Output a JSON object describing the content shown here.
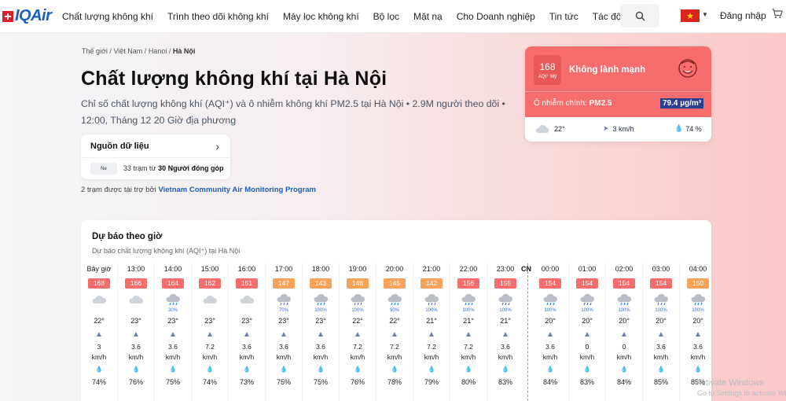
{
  "nav": {
    "logo": "IQAir",
    "items": [
      "Chất lượng không khí",
      "Trình theo dõi không khí",
      "Máy lọc không khí",
      "Bộ lọc",
      "Mặt nạ",
      "Cho Doanh nghiệp",
      "Tin tức",
      "Tác động"
    ],
    "login": "Đăng nhập"
  },
  "breadcrumb": {
    "world": "Thế giới",
    "country": "Việt Nam",
    "city": "Hanoi",
    "current": "Hà Nội"
  },
  "title": "Chất lượng không khí tại Hà Nội",
  "description": "Chỉ số chất lượng không khí (AQI⁺) và ô nhiễm không khí PM2.5 tại Hà Nội • 2.9M người theo dõi • 12:00, Tháng 12 20 Giờ địa phương",
  "source": {
    "title": "Nguồn dữ liệu",
    "logo_text": "Ne",
    "text_a": "33 trạm từ",
    "text_b": "30 Người đóng góp"
  },
  "sponsor": {
    "prefix": "2 trạm được tài trợ bởi",
    "link": "Vietnam Community Air Monitoring Program"
  },
  "aqi": {
    "value": "168",
    "unit": "AQI⁺ Mỹ",
    "status": "Không lành mạnh",
    "pollutant_label": "Ô nhiễm chính:",
    "pollutant": "PM2.5",
    "concentration": "79.4 µg/m³",
    "temp": "22°",
    "wind": "3 km/h",
    "humidity": "74 %",
    "colors": {
      "card": "#f76d6d",
      "badge": "#e85858"
    }
  },
  "forecast": {
    "title": "Dự báo theo giờ",
    "subtitle": "Dự báo chất lượng không khí (AQI⁺) tại Hà Nội",
    "day_marker": "CN",
    "hours": [
      {
        "time": "Bây giờ",
        "aqi": "168",
        "level": "red",
        "icon": "cloud-icon",
        "rain": "",
        "temp": "22°",
        "wind": "3",
        "unit": "km/h",
        "hum": "74%"
      },
      {
        "time": "13:00",
        "aqi": "166",
        "level": "red",
        "icon": "cloud-icon",
        "rain": "",
        "temp": "23°",
        "wind": "3.6",
        "unit": "km/h",
        "hum": "76%"
      },
      {
        "time": "14:00",
        "aqi": "164",
        "level": "red",
        "icon": "rain-cloud-icon",
        "rain": "30%",
        "temp": "23°",
        "wind": "3.6",
        "unit": "km/h",
        "hum": "75%"
      },
      {
        "time": "15:00",
        "aqi": "162",
        "level": "red",
        "icon": "cloud-icon",
        "rain": "",
        "temp": "23°",
        "wind": "7.2",
        "unit": "km/h",
        "hum": "74%"
      },
      {
        "time": "16:00",
        "aqi": "151",
        "level": "red",
        "icon": "cloud-icon",
        "rain": "",
        "temp": "23°",
        "wind": "3.6",
        "unit": "km/h",
        "hum": "73%"
      },
      {
        "time": "17:00",
        "aqi": "147",
        "level": "orange",
        "icon": "rain-cloud-icon",
        "rain": "70%",
        "temp": "23°",
        "wind": "3.6",
        "unit": "km/h",
        "hum": "75%"
      },
      {
        "time": "18:00",
        "aqi": "143",
        "level": "orange",
        "icon": "rain-cloud-icon",
        "rain": "100%",
        "temp": "23°",
        "wind": "3.6",
        "unit": "km/h",
        "hum": "75%"
      },
      {
        "time": "19:00",
        "aqi": "148",
        "level": "orange",
        "icon": "rain-cloud-icon",
        "rain": "100%",
        "temp": "22°",
        "wind": "7.2",
        "unit": "km/h",
        "hum": "76%"
      },
      {
        "time": "20:00",
        "aqi": "145",
        "level": "orange",
        "icon": "rain-cloud-icon",
        "rain": "90%",
        "temp": "22°",
        "wind": "7.2",
        "unit": "km/h",
        "hum": "78%"
      },
      {
        "time": "21:00",
        "aqi": "142",
        "level": "orange",
        "icon": "rain-cloud-icon",
        "rain": "100%",
        "temp": "21°",
        "wind": "7.2",
        "unit": "km/h",
        "hum": "79%"
      },
      {
        "time": "22:00",
        "aqi": "156",
        "level": "red",
        "icon": "rain-cloud-icon",
        "rain": "100%",
        "temp": "21°",
        "wind": "7.2",
        "unit": "km/h",
        "hum": "80%"
      },
      {
        "time": "23:00",
        "aqi": "155",
        "level": "red",
        "icon": "rain-cloud-icon",
        "rain": "100%",
        "temp": "21°",
        "wind": "3.6",
        "unit": "km/h",
        "hum": "83%"
      },
      {
        "time": "00:00",
        "aqi": "154",
        "level": "red",
        "icon": "rain-cloud-icon",
        "rain": "100%",
        "temp": "20°",
        "wind": "3.6",
        "unit": "km/h",
        "hum": "84%"
      },
      {
        "time": "01:00",
        "aqi": "154",
        "level": "red",
        "icon": "rain-cloud-icon",
        "rain": "100%",
        "temp": "20°",
        "wind": "0",
        "unit": "km/h",
        "hum": "83%"
      },
      {
        "time": "02:00",
        "aqi": "154",
        "level": "red",
        "icon": "rain-cloud-icon",
        "rain": "100%",
        "temp": "20°",
        "wind": "0",
        "unit": "km/h",
        "hum": "84%"
      },
      {
        "time": "03:00",
        "aqi": "154",
        "level": "red",
        "icon": "rain-cloud-icon",
        "rain": "100%",
        "temp": "20°",
        "wind": "3.6",
        "unit": "km/h",
        "hum": "85%"
      },
      {
        "time": "04:00",
        "aqi": "150",
        "level": "orange",
        "icon": "rain-cloud-icon",
        "rain": "100%",
        "temp": "20°",
        "wind": "3.6",
        "unit": "km/h",
        "hum": "85%"
      }
    ],
    "level_colors": {
      "red": "#f76d6d",
      "orange": "#f9a25a"
    }
  },
  "watermark": {
    "line1": "Activate Windows",
    "line2": "Go to Settings to activate Windows."
  }
}
